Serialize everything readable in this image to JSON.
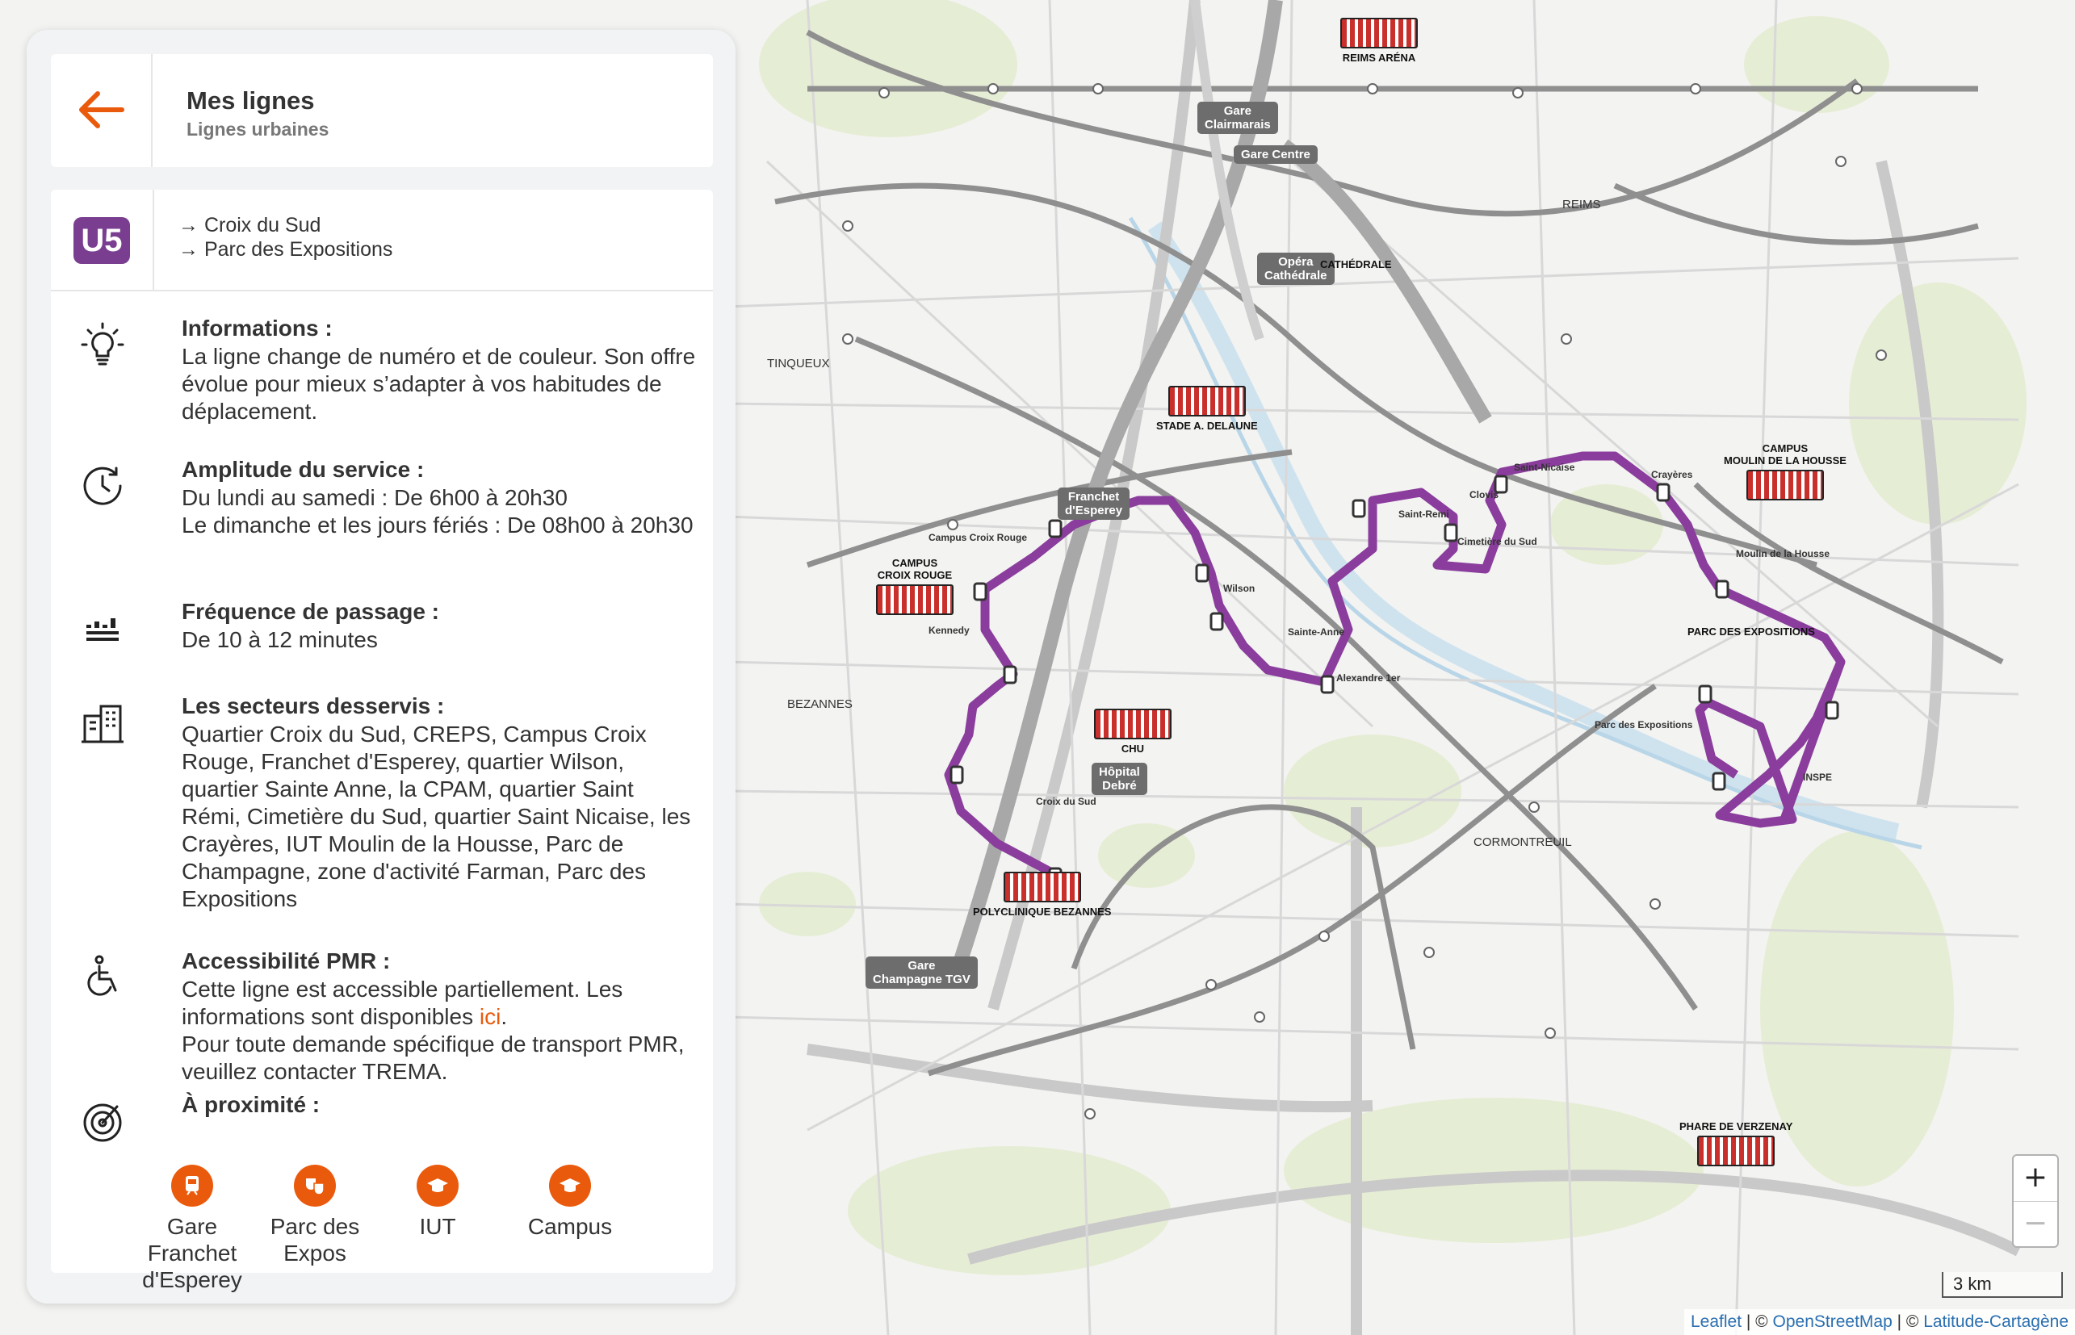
{
  "header": {
    "title": "Mes lignes",
    "subtitle": "Lignes urbaines",
    "back_icon": "arrow-left-icon"
  },
  "line": {
    "code": "U5",
    "color": "#7a3e90",
    "destinations": [
      "→ Croix du Sud",
      "→ Parc des Expositions"
    ]
  },
  "sections": {
    "info": {
      "heading": "Informations :",
      "text": "La ligne change de numéro et de couleur. Son offre évolue pour mieux s’adapter à vos habitudes de déplacement."
    },
    "amplitude": {
      "heading": "Amplitude du service :",
      "text": "Du lundi au samedi : De 6h00 à 20h30\nLe dimanche et les jours fériés : De 08h00 à 20h30"
    },
    "frequency": {
      "heading": "Fréquence de passage :",
      "text": "De 10 à 12 minutes"
    },
    "sectors": {
      "heading": "Les secteurs desservis :",
      "text": "Quartier Croix du Sud, CREPS, Campus Croix Rouge, Franchet d'Esperey, quartier Wilson, quartier Sainte Anne, la CPAM, quartier Saint Rémi, Cimetière du Sud, quartier Saint Nicaise, les Crayères, IUT Moulin de la Housse, Parc de Champagne, zone d'activité Farman, Parc des Expositions"
    },
    "pmr": {
      "heading": "Accessibilité PMR :",
      "text_before": "Cette ligne est accessible partiellement. Les informations sont disponibles ",
      "link": "ici",
      "text_after": ".",
      "text2": "Pour toute demande spécifique de transport PMR, veuillez contacter TREMA."
    },
    "nearby": {
      "heading": "À proximité :",
      "items": [
        {
          "label": "Gare\nFranchet\nd'Esperey",
          "icon": "train-icon"
        },
        {
          "label": "Parc des\nExpos",
          "icon": "theater-masks-icon"
        },
        {
          "label": "IUT",
          "icon": "graduation-cap-icon"
        },
        {
          "label": "Campus",
          "icon": "graduation-cap-icon"
        }
      ]
    }
  },
  "map": {
    "accent": "#8a3d9c",
    "stations": [
      "Gare\nClairmarais",
      "Gare Centre",
      "Opéra\nCathédrale",
      "Franchet\nd'Esperey",
      "Hôpital\nDebré",
      "Gare\nChampagne TGV"
    ],
    "landmarks": [
      "REIMS ARÉNA",
      "CATHÉDRALE",
      "STADE A. DELAUNE",
      "CAMPUS\nCROIX ROUGE",
      "CHU",
      "POLYCLINIQUE BEZANNES",
      "CAMPUS\nMOULIN DE LA HOUSSE",
      "PARC DES EXPOSITIONS",
      "PHARE DE VERZENAY"
    ],
    "u5_stops": [
      "Croix du Sud",
      "Kennedy",
      "Campus\nCroix Rouge",
      "Franchet\nd'Esperey",
      "Wilson",
      "Sainte-Anne",
      "Alexandre 1er",
      "Saint-Remi",
      "Cimetière\ndu Sud",
      "Clovis",
      "Saint-Nicaise",
      "Crayères",
      "Moulin de la Housse",
      "Parc des Expositions",
      "INSPE"
    ],
    "districts": [
      "REIMS",
      "TINQUEUX",
      "BEZANNES",
      "CORMONTREUIL"
    ],
    "zoom_in": "+",
    "zoom_out": "−",
    "scale": "3 km",
    "attribution": {
      "leaflet": "Leaflet",
      "sep1": " | © ",
      "osm": "OpenStreetMap",
      "sep2": " | © ",
      "lc": "Latitude-Cartagène"
    }
  }
}
